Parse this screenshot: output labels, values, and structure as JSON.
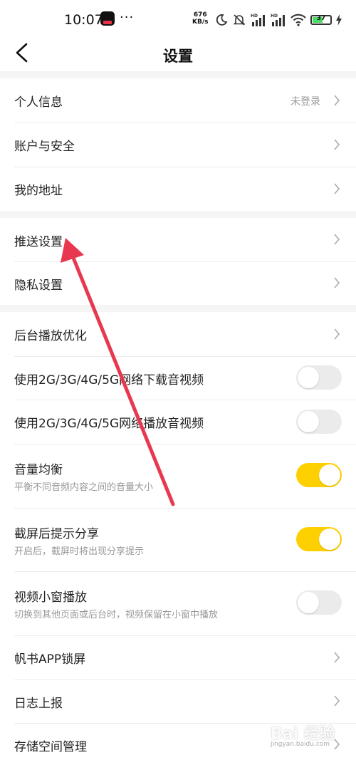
{
  "status_bar": {
    "time": "10:07",
    "dots": "···",
    "net_speed_value": "676",
    "net_speed_unit": "KB/s",
    "hd1": "HD",
    "hd2": "HD",
    "battery": "37"
  },
  "header": {
    "title": "设置"
  },
  "groups": {
    "account": {
      "profile": {
        "label": "个人信息",
        "value": "未登录"
      },
      "security": {
        "label": "账户与安全"
      },
      "address": {
        "label": "我的地址"
      }
    },
    "privacy": {
      "push": {
        "label": "推送设置"
      },
      "privacy": {
        "label": "隐私设置"
      }
    },
    "playback": {
      "background": {
        "label": "后台播放优化"
      },
      "download_mobile": {
        "label": "使用2G/3G/4G/5G网络下载音视频",
        "on": false
      },
      "play_mobile": {
        "label": "使用2G/3G/4G/5G网络播放音视频",
        "on": false
      },
      "volume_balance": {
        "label": "音量均衡",
        "sub": "平衡不同音频内容之间的音量大小",
        "on": true
      },
      "screenshot_share": {
        "label": "截屏后提示分享",
        "sub": "开启后，截屏时将出现分享提示",
        "on": true
      },
      "mini_window": {
        "label": "视频小窗播放",
        "sub": "切换到其他页面或后台时，视频保留在小窗中播放",
        "on": false
      },
      "lock_screen": {
        "label": "帆书APP锁屏"
      },
      "log_report": {
        "label": "日志上报"
      },
      "storage": {
        "label": "存储空间管理"
      }
    }
  },
  "watermark": {
    "text": "Bai 经验",
    "sub": "jingyan.baidu.com"
  },
  "colors": {
    "toggle_on": "#ffd000",
    "toggle_off": "#ebebeb",
    "arrow": "#e8384f"
  }
}
